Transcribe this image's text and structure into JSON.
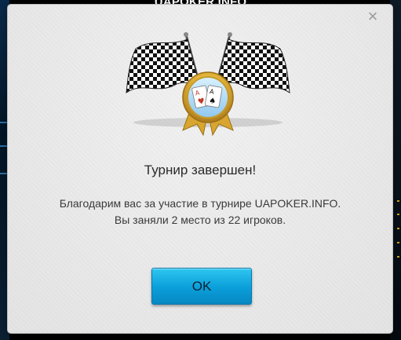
{
  "window": {
    "title": "UAPOKER.INFO"
  },
  "dialog": {
    "close_icon": "close-icon",
    "emblem_icon": "checkered-flags-cards-medal-icon",
    "title": "Турнир завершен!",
    "message_line1": "Благодарим вас за участие в турнире UAPOKER.INFO.",
    "message_line2": "Вы заняли 2 место из 22 игроков.",
    "ok_label": "OK"
  },
  "colors": {
    "dialog_bg": "#ececec",
    "button_top": "#2fc6f0",
    "button_bottom": "#0788c2",
    "title_text": "#2b2b2b"
  }
}
